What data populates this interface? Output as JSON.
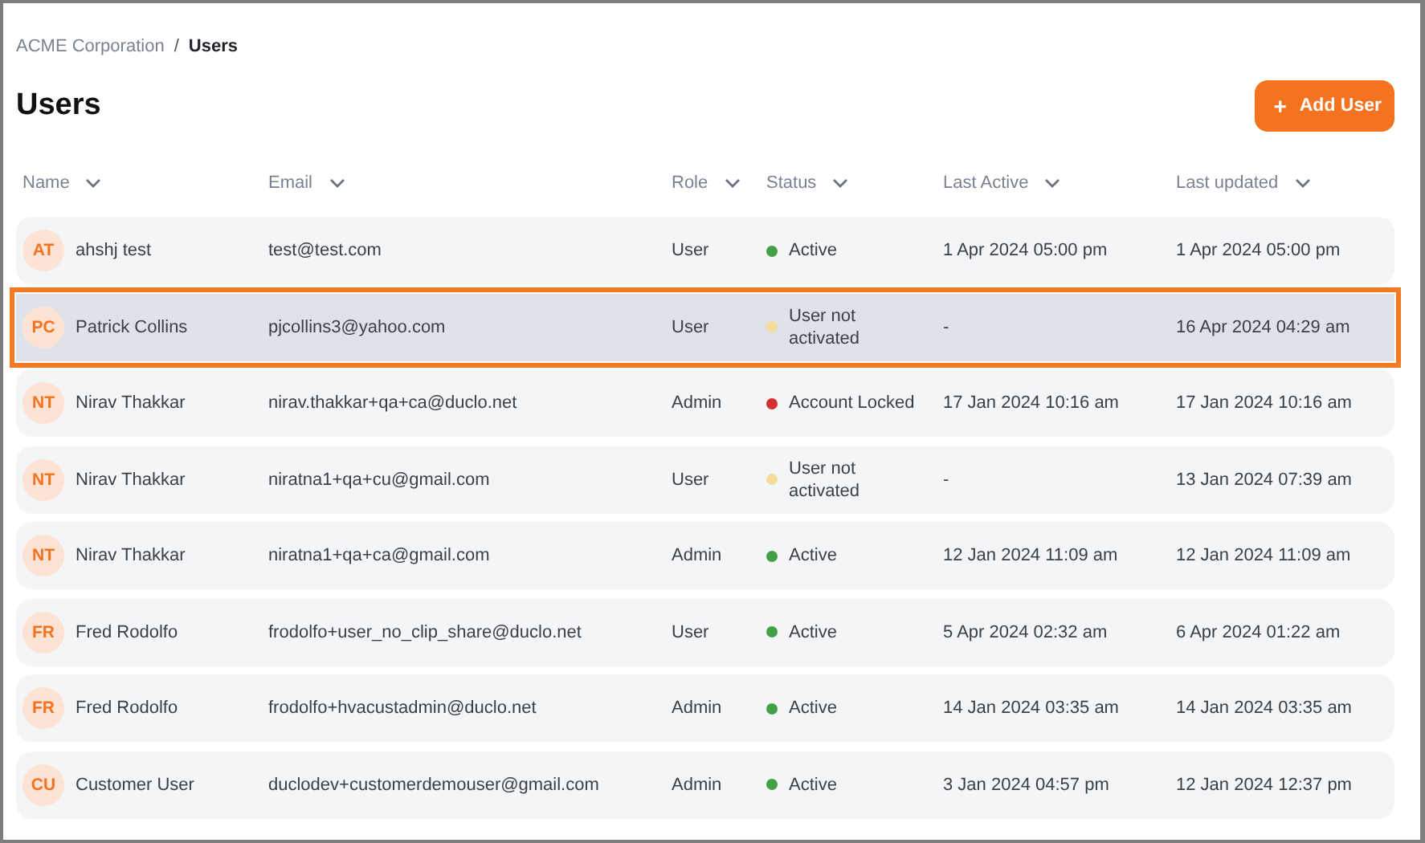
{
  "breadcrumb": {
    "items": [
      {
        "label": "ACME Corporation",
        "current": false
      },
      {
        "label": "Users",
        "current": true
      }
    ],
    "separator": "/"
  },
  "title": "Users",
  "add_button": {
    "icon": "+",
    "label": "Add User"
  },
  "table": {
    "columns": [
      "Name",
      "Email",
      "Role",
      "Status",
      "Last Active",
      "Last updated"
    ],
    "rows": [
      {
        "initials": "AT",
        "name": "ahshj test",
        "email": "test@test.com",
        "role": "User",
        "status": "Active",
        "color": "#43a047",
        "last_active": "1 Apr 2024 05:00 pm",
        "last_updated": "1 Apr 2024 05:00 pm",
        "selected": false
      },
      {
        "initials": "PC",
        "name": "Patrick Collins",
        "email": "pjcollins3@yahoo.com",
        "role": "User",
        "status": "User not activated",
        "color": "#f5dc9a",
        "last_active": "-",
        "last_updated": "16 Apr 2024 04:29 am",
        "selected": true
      },
      {
        "initials": "NT",
        "name": "Nirav Thakkar",
        "email": "nirav.thakkar+qa+ca@duclo.net",
        "role": "Admin",
        "status": "Account Locked",
        "color": "#d32f2f",
        "last_active": "17 Jan 2024 10:16 am",
        "last_updated": "17 Jan 2024 10:16 am",
        "selected": false
      },
      {
        "initials": "NT",
        "name": "Nirav Thakkar",
        "email": "niratna1+qa+cu@gmail.com",
        "role": "User",
        "status": "User not activated",
        "color": "#f5dc9a",
        "last_active": "-",
        "last_updated": "13 Jan 2024 07:39 am",
        "selected": false
      },
      {
        "initials": "NT",
        "name": "Nirav Thakkar",
        "email": "niratna1+qa+ca@gmail.com",
        "role": "Admin",
        "status": "Active",
        "color": "#43a047",
        "last_active": "12 Jan 2024 11:09 am",
        "last_updated": "12 Jan 2024 11:09 am",
        "selected": false
      },
      {
        "initials": "FR",
        "name": "Fred Rodolfo",
        "email": "frodolfo+user_no_clip_share@duclo.net",
        "role": "User",
        "status": "Active",
        "color": "#43a047",
        "last_active": "5 Apr 2024 02:32 am",
        "last_updated": "6 Apr 2024 01:22 am",
        "selected": false
      },
      {
        "initials": "FR",
        "name": "Fred Rodolfo",
        "email": "frodolfo+hvacustadmin@duclo.net",
        "role": "Admin",
        "status": "Active",
        "color": "#43a047",
        "last_active": "14 Jan 2024 03:35 am",
        "last_updated": "14 Jan 2024 03:35 am",
        "selected": false
      },
      {
        "initials": "CU",
        "name": "Customer User",
        "email": "duclodev+customerdemouser@gmail.com",
        "role": "Admin",
        "status": "Active",
        "color": "#43a047",
        "last_active": "3 Jan 2024 04:57 pm",
        "last_updated": "12 Jan 2024 12:37 pm",
        "selected": false
      }
    ]
  }
}
